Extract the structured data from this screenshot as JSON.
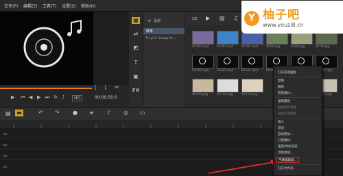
{
  "menubar": {
    "items": [
      "文件(F)",
      "编辑(E)",
      "工具(T)",
      "设置(S)",
      "帮助(H)"
    ]
  },
  "preview": {
    "time": "00:00:50:0"
  },
  "library": {
    "selected_folder": "样本",
    "clip_name": "Triple Scoop M...",
    "captions": [
      "SP-V03.mp4",
      "SP-V02.mp4",
      "SP-V01.mp4",
      "SP-I03.jpg",
      "SP-I02.jpg",
      "SP-I01.jpg",
      "SP-S03.mpa",
      "SP-S02.mpa",
      "SP-S01.mpa",
      "SP-M03.mpa",
      "SP-M02.mpa",
      "SP-M01.mpa",
      "SP-C03.png",
      "SP-C02.png",
      "SP-C01.png",
      "SP-A01.png"
    ]
  },
  "context_menu": {
    "items": [
      {
        "label": "打开选项面板",
        "enabled": true
      },
      {
        "label": "复制",
        "enabled": true
      },
      {
        "label": "删除",
        "enabled": true
      },
      {
        "label": "链接素材...",
        "enabled": true
      },
      {
        "label": "复制属性",
        "enabled": true
      },
      {
        "label": "粘贴所有属性",
        "enabled": false
      },
      {
        "label": "粘贴可选属性",
        "enabled": false
      },
      {
        "label": "插入",
        "enabled": true
      },
      {
        "label": "退出",
        "enabled": true
      },
      {
        "label": "自动摇动...",
        "enabled": true
      },
      {
        "label": "分割素材",
        "enabled": true
      },
      {
        "label": "速度/时间流逝...",
        "enabled": true
      },
      {
        "label": "音频滤镜...",
        "enabled": true
      },
      {
        "label": "字幕编辑器...",
        "enabled": true
      },
      {
        "label": "打开文件夹...",
        "enabled": true
      }
    ]
  },
  "watermark": {
    "logo_letter": "Y",
    "title": "柚子吧",
    "url": "www.youzi8.cn"
  },
  "colors": {
    "accent": "#f29a1a",
    "highlight_box": "#d9352b",
    "arrow": "#e0302a"
  }
}
